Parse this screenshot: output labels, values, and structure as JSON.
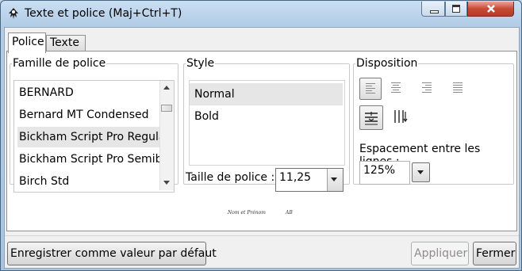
{
  "window": {
    "title": "Texte et police (Maj+Ctrl+T)"
  },
  "tabs": [
    {
      "label": "Police",
      "active": true
    },
    {
      "label": "Texte",
      "active": false
    }
  ],
  "font_family": {
    "legend": "Famille de police",
    "items": [
      "BERNARD",
      "Bernard MT Condensed",
      "Bickham Script Pro Regular",
      "Bickham Script Pro Semibold",
      "Birch Std"
    ],
    "selected_index": 2
  },
  "style": {
    "legend": "Style",
    "items": [
      "Normal",
      "Bold"
    ],
    "selected_index": 0,
    "size_label": "Taille de police :",
    "size_value": "11,25"
  },
  "disposition": {
    "legend": "Disposition",
    "align_buttons": [
      "align-left-icon",
      "align-center-icon",
      "align-right-icon",
      "align-justify-icon"
    ],
    "orientation_buttons": [
      "horizontal-text-icon",
      "vertical-text-icon"
    ],
    "spacing_label": "Espacement entre les lignes :",
    "spacing_value": "125%"
  },
  "preview": {
    "text_left": "Nom et Prénom",
    "text_right": "AB"
  },
  "buttons": {
    "default_label": "Enregistrer comme valeur par défaut",
    "apply_label": "Appliquer",
    "close_label": "Fermer"
  },
  "colors": {
    "selection": "#e6e6e6",
    "title_bar": "#b9d1ea",
    "close_button": "#c74a34"
  }
}
